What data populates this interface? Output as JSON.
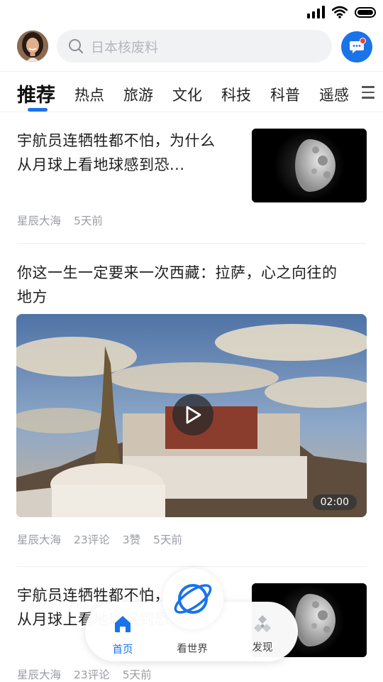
{
  "search": {
    "placeholder": "日本核废料"
  },
  "tabs": [
    {
      "label": "推荐"
    },
    {
      "label": "热点"
    },
    {
      "label": "旅游"
    },
    {
      "label": "文化"
    },
    {
      "label": "科技"
    },
    {
      "label": "科普"
    },
    {
      "label": "遥感"
    }
  ],
  "articles": [
    {
      "title_line1": "宇航员连牺牲都不怕，为什么",
      "title_line2": "从月球上看地球感到恐...",
      "source": "星辰大海",
      "time": "5天前"
    },
    {
      "title_line1": "你这一生一定要来一次西藏：拉萨，心之向往的",
      "title_line2": "地方",
      "video_duration": "02:00",
      "source": "星辰大海",
      "comments": "23评论",
      "likes": "3赞",
      "time": "5天前"
    },
    {
      "title_line1": "宇航员连牺牲都不怕，为什么",
      "title_line2": "从月球上看地球感到恐...",
      "source": "星辰大海",
      "comments": "23评论",
      "time": "5天前"
    }
  ],
  "bottom_nav": {
    "home": "首页",
    "world": "看世界",
    "discover": "发现"
  },
  "colors": {
    "accent": "#1a73e8",
    "badge": "#ff3b30",
    "meta_text": "#9a9da3"
  },
  "icons": [
    "signal-icon",
    "wifi-icon",
    "battery-icon",
    "search-icon",
    "message-icon",
    "menu-icon",
    "play-icon",
    "home-icon",
    "globe-icon",
    "discover-icon"
  ]
}
